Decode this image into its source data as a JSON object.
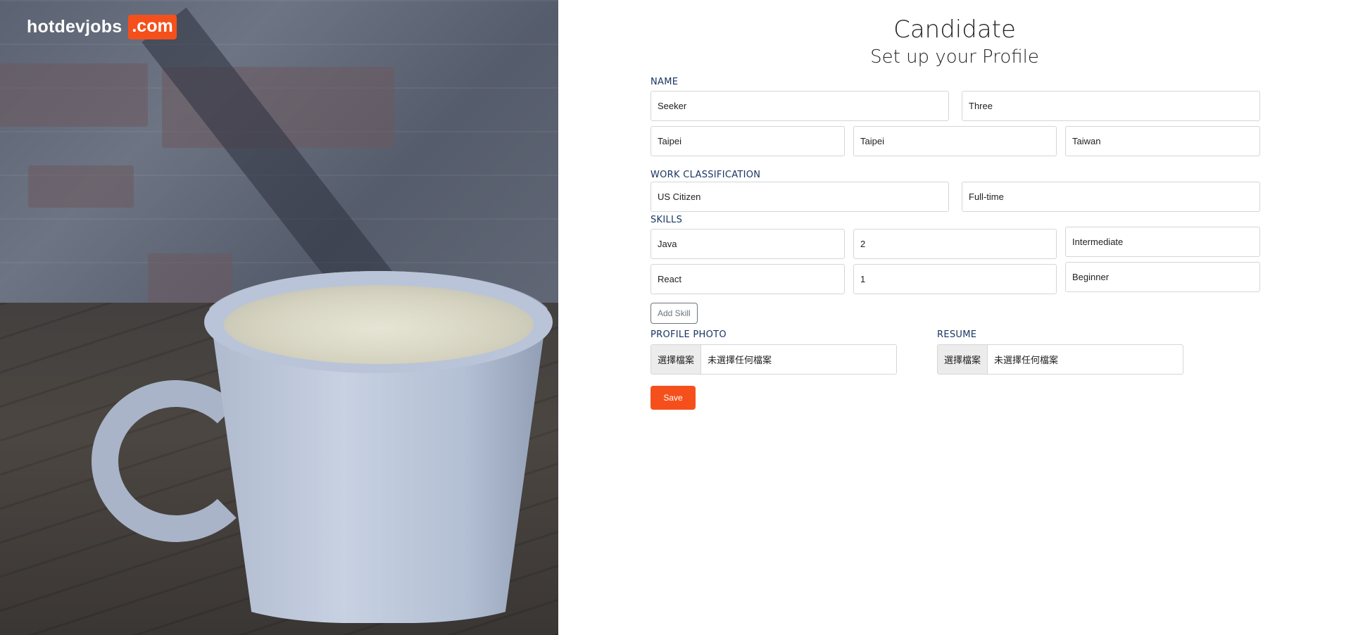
{
  "brand": {
    "name": "hotdevjobs",
    "tld": ".com",
    "accent": "#f5501b"
  },
  "header": {
    "title": "Candidate",
    "subtitle": "Set up your Profile"
  },
  "name_section": {
    "label": "NAME",
    "first_name": "Seeker",
    "last_name": "Three",
    "city": "Taipei",
    "state": "Taipei",
    "country": "Taiwan"
  },
  "work_section": {
    "label": "WORK CLASSIFICATION",
    "status": "US Citizen",
    "type": "Full-time"
  },
  "skills_section": {
    "label": "SKILLS",
    "items": [
      {
        "name": "Java",
        "years": "2",
        "level": "Intermediate"
      },
      {
        "name": "React",
        "years": "1",
        "level": "Beginner"
      }
    ],
    "add_label": "Add Skill"
  },
  "photo_section": {
    "label": "PROFILE PHOTO",
    "button": "選擇檔案",
    "status": "未選擇任何檔案"
  },
  "resume_section": {
    "label": "RESUME",
    "button": "選擇檔案",
    "status": "未選擇任何檔案"
  },
  "save_label": "Save"
}
